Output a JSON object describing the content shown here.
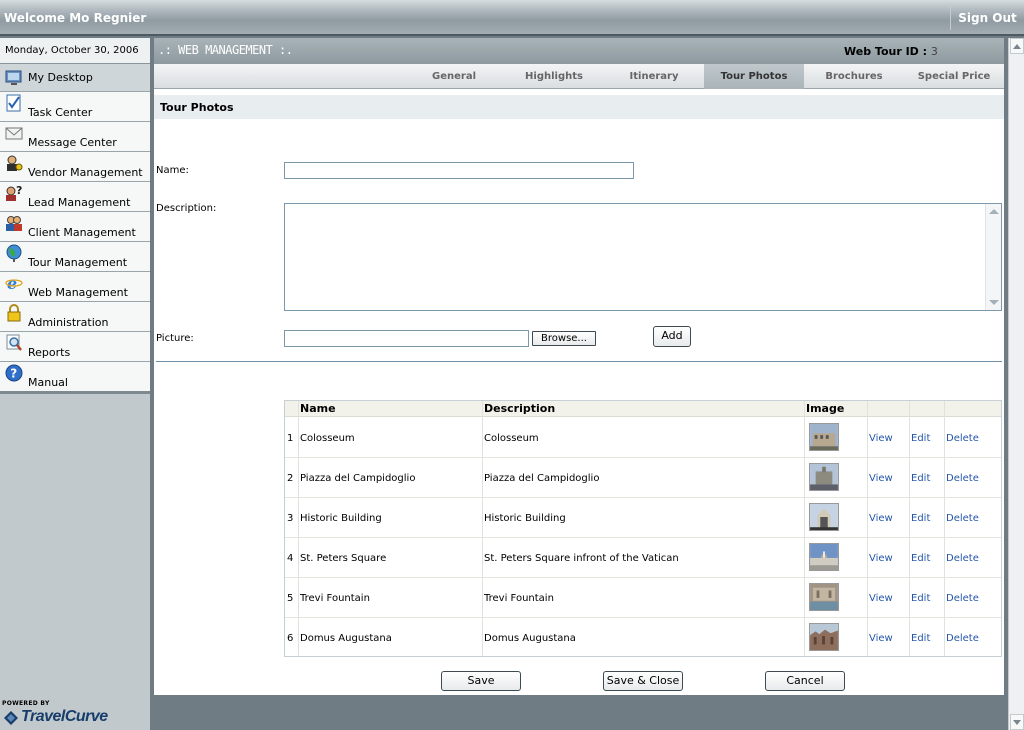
{
  "header": {
    "welcome": "Welcome Mo Regnier",
    "sign_out": "Sign Out"
  },
  "sidebar": {
    "date": "Monday, October 30, 2006",
    "items": [
      {
        "label": "My Desktop",
        "icon": "desktop-icon"
      },
      {
        "label": "Task Center",
        "icon": "task-icon"
      },
      {
        "label": "Message Center",
        "icon": "envelope-icon"
      },
      {
        "label": "Vendor Management",
        "icon": "vendor-icon"
      },
      {
        "label": "Lead Management",
        "icon": "lead-icon"
      },
      {
        "label": "Client Management",
        "icon": "clients-icon"
      },
      {
        "label": "Tour Management",
        "icon": "globe-icon"
      },
      {
        "label": "Web Management",
        "icon": "internet-explorer-icon"
      },
      {
        "label": "Administration",
        "icon": "lock-icon"
      },
      {
        "label": "Reports",
        "icon": "magnifier-icon"
      },
      {
        "label": "Manual",
        "icon": "help-icon"
      }
    ],
    "powered_by": "POWERED BY",
    "brand": "TravelCurve"
  },
  "main": {
    "section_title": ".: WEB MANAGEMENT :.",
    "tour_id_label": "Web Tour ID :",
    "tour_id_value": "3",
    "tabs": [
      {
        "label": "General",
        "active": false
      },
      {
        "label": "Highlights",
        "active": false
      },
      {
        "label": "Itinerary",
        "active": false
      },
      {
        "label": "Tour Photos",
        "active": true
      },
      {
        "label": "Brochures",
        "active": false
      },
      {
        "label": "Special Price",
        "active": false
      }
    ],
    "panel_title": "Tour Photos"
  },
  "form": {
    "name_label": "Name:",
    "name_value": "",
    "description_label": "Description:",
    "description_value": "",
    "picture_label": "Picture:",
    "picture_value": "",
    "browse_label": "Browse...",
    "add_label": "Add"
  },
  "photos": {
    "columns": [
      "Name",
      "Description",
      "Image"
    ],
    "rows": [
      {
        "num": "1",
        "name": "Colosseum",
        "description": "Colosseum",
        "thumb_color": "#8a97a8"
      },
      {
        "num": "2",
        "name": "Piazza del Campidoglio",
        "description": "Piazza del Campidoglio",
        "thumb_color": "#9aa7b6"
      },
      {
        "num": "3",
        "name": "Historic Building",
        "description": "Historic Building",
        "thumb_color": "#a4afbd"
      },
      {
        "num": "4",
        "name": "St. Peters Square",
        "description": "St. Peters Square infront of the Vatican",
        "thumb_color": "#7f97b8"
      },
      {
        "num": "5",
        "name": "Trevi Fountain",
        "description": "Trevi Fountain",
        "thumb_color": "#9a8f86"
      },
      {
        "num": "6",
        "name": "Domus Augustana",
        "description": "Domus Augustana",
        "thumb_color": "#8f7a6e"
      }
    ],
    "view_label": "View",
    "edit_label": "Edit",
    "delete_label": "Delete"
  },
  "actions": {
    "save": "Save",
    "save_close": "Save & Close",
    "cancel": "Cancel"
  },
  "colors": {
    "link": "#2456a8",
    "brand": "#173d6b",
    "header_gray": "#8f9ba2"
  }
}
